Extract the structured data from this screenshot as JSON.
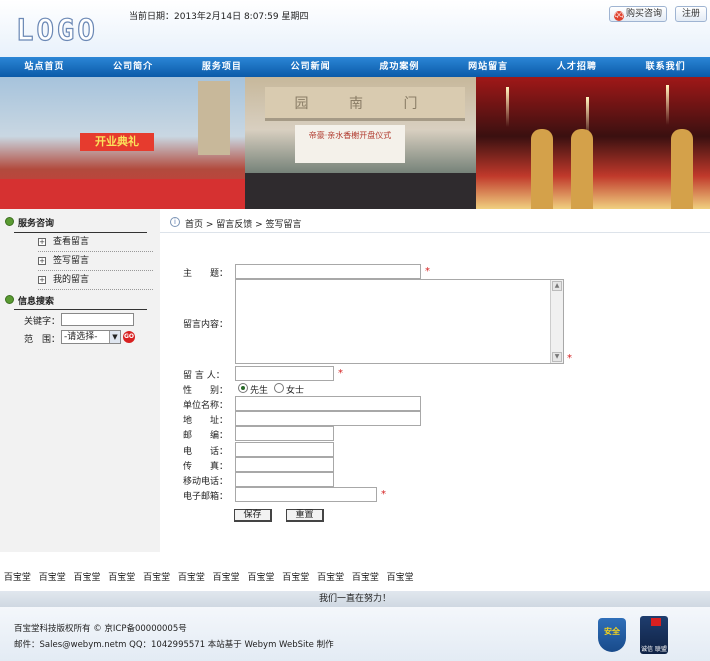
{
  "header": {
    "logo": "LOGO",
    "date": "当前日期：2013年2月14日 8:07:59 星期四",
    "buy_button": "购买咨询",
    "register_button": "注册"
  },
  "nav": [
    "站点首页",
    "公司简介",
    "服务项目",
    "公司新闻",
    "成功案例",
    "网站留言",
    "人才招聘",
    "联系我们"
  ],
  "banner": {
    "photo1_text": "开业典礼",
    "photo2_sign": "园 南 门",
    "photo2_board": "帝豪·亲水香榭开盘仪式"
  },
  "sidebar": {
    "consult_title": "服务咨询",
    "consult_items": [
      "查看留言",
      "签写留言",
      "我的留言"
    ],
    "search_title": "信息搜索",
    "keyword_label": "关键字：",
    "scope_label": "范　围：",
    "scope_value": "-请选择-",
    "go_label": "GO"
  },
  "breadcrumb": "首页 > 留言反馈 > 签写留言",
  "form": {
    "subject": "主　　题：",
    "content": "留言内容：",
    "author": "留 言 人：",
    "gender": "性　　别：",
    "gender_male": "先生",
    "gender_female": "女士",
    "company": "单位名称：",
    "address": "地　　址：",
    "postcode": "邮　　编：",
    "phone": "电　　话：",
    "fax": "传　　真：",
    "mobile": "移动电话：",
    "email": "电子邮箱：",
    "required_mark": "*",
    "save_button": "保存",
    "reset_button": "重置"
  },
  "footer": {
    "links": [
      "百宝堂",
      "百宝堂",
      "百宝堂",
      "百宝堂",
      "百宝堂",
      "百宝堂",
      "百宝堂",
      "百宝堂",
      "百宝堂",
      "百宝堂",
      "百宝堂",
      "百宝堂"
    ],
    "slogan": "我们一直在努力！",
    "copyright": "百宝堂科技版权所有 © 京ICP备00000005号",
    "contact": "邮件：Sales@webym.netm QQ：1042995571  本站基于 Webym WebSite 制作",
    "badge1_text": "安全",
    "badge2_text": "诚信 联盟"
  },
  "colors": {
    "nav_bg": "#0b5aa8",
    "required": "#d41f1f",
    "sidebar_bg": "#f2f2f2"
  }
}
